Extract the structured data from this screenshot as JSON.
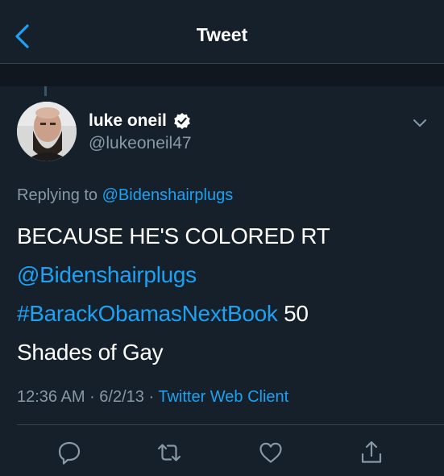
{
  "header": {
    "title": "Tweet",
    "back_icon": "chevron-left-icon"
  },
  "tweet": {
    "author_name": "luke oneil",
    "verified_icon": "verified-badge-icon",
    "handle": "@lukeoneil47",
    "menu_icon": "chevron-down-icon",
    "replying_prefix": "Replying to",
    "replying_to": "@Bidenshairplugs",
    "text_line1": "BECAUSE HE'S COLORED RT",
    "mention": "@Bidenshairplugs",
    "hashtag": "#BarackObamasNextBook",
    "text_after_hashtag": " 50",
    "text_line4": "Shades of Gay",
    "time": "12:36 AM",
    "date": "6/2/13",
    "separator": " · ",
    "source": "Twitter Web Client"
  },
  "actions": [
    "reply-icon",
    "retweet-icon",
    "like-icon",
    "share-icon"
  ],
  "colors": {
    "background": "#15202b",
    "accent": "#1da1f2",
    "secondary_text": "#8899a6",
    "divider": "#38444d"
  }
}
